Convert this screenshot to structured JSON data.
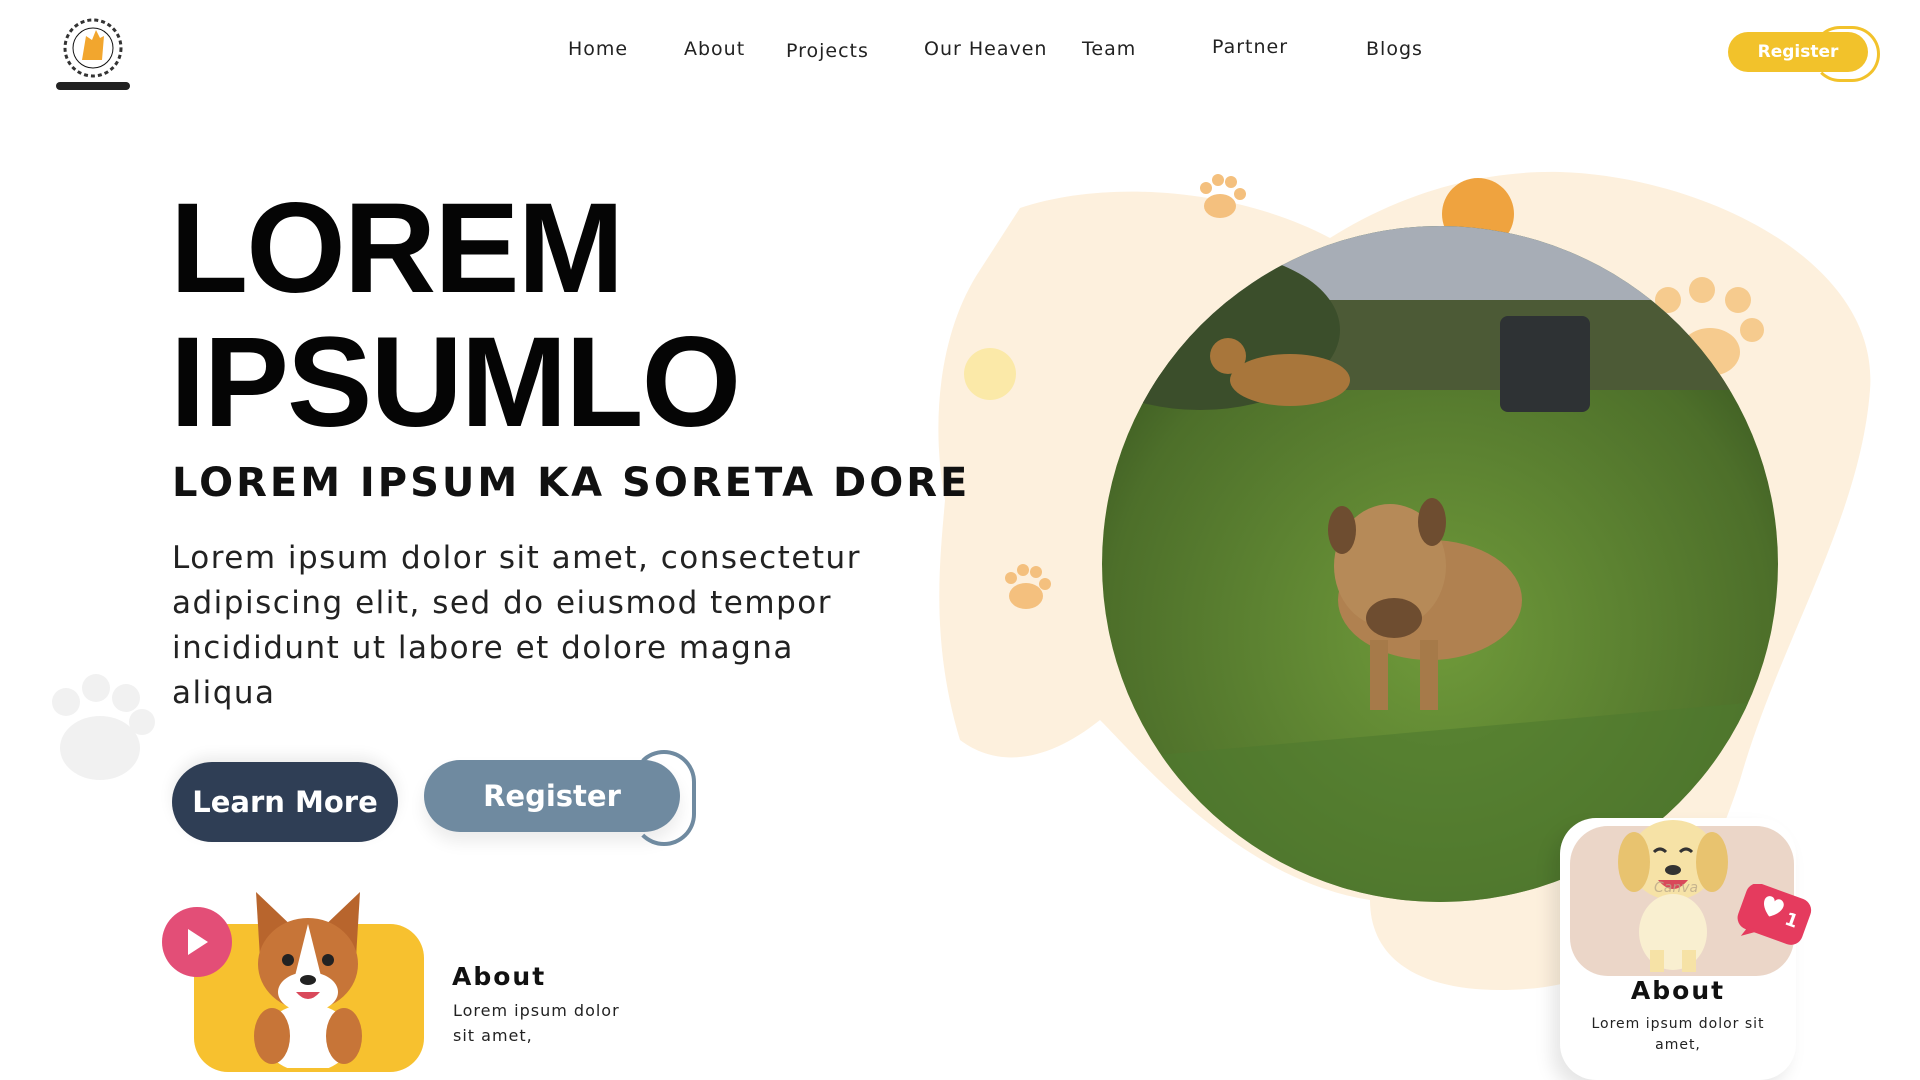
{
  "nav": {
    "items": [
      "Home",
      "About",
      "Projects",
      "Our Heaven",
      "Team",
      "Partner",
      "Blogs"
    ],
    "register_label": "Register"
  },
  "hero": {
    "title_line1": "LOREM",
    "title_line2": "IPSUMLO",
    "subtitle": "LOREM IPSUM KA SORETA DORE",
    "body": "Lorem ipsum dolor sit amet, consectetur adipiscing elit, sed do eiusmod tempor incididunt ut labore et dolore magna aliqua",
    "learn_more_label": "Learn More",
    "register_label": "Register"
  },
  "card_left": {
    "title": "About",
    "text": "Lorem ipsum dolor sit amet,"
  },
  "card_right": {
    "title": "About",
    "text": "Lorem ipsum dolor sit amet,",
    "likes": "1",
    "image_watermark": "Canva"
  },
  "colors": {
    "accent_yellow": "#f2c22b",
    "navy": "#2f3e55",
    "slate": "#6f8aa0",
    "pink": "#e34e77",
    "blob": "#fdf0dd",
    "orange": "#efa33f"
  }
}
